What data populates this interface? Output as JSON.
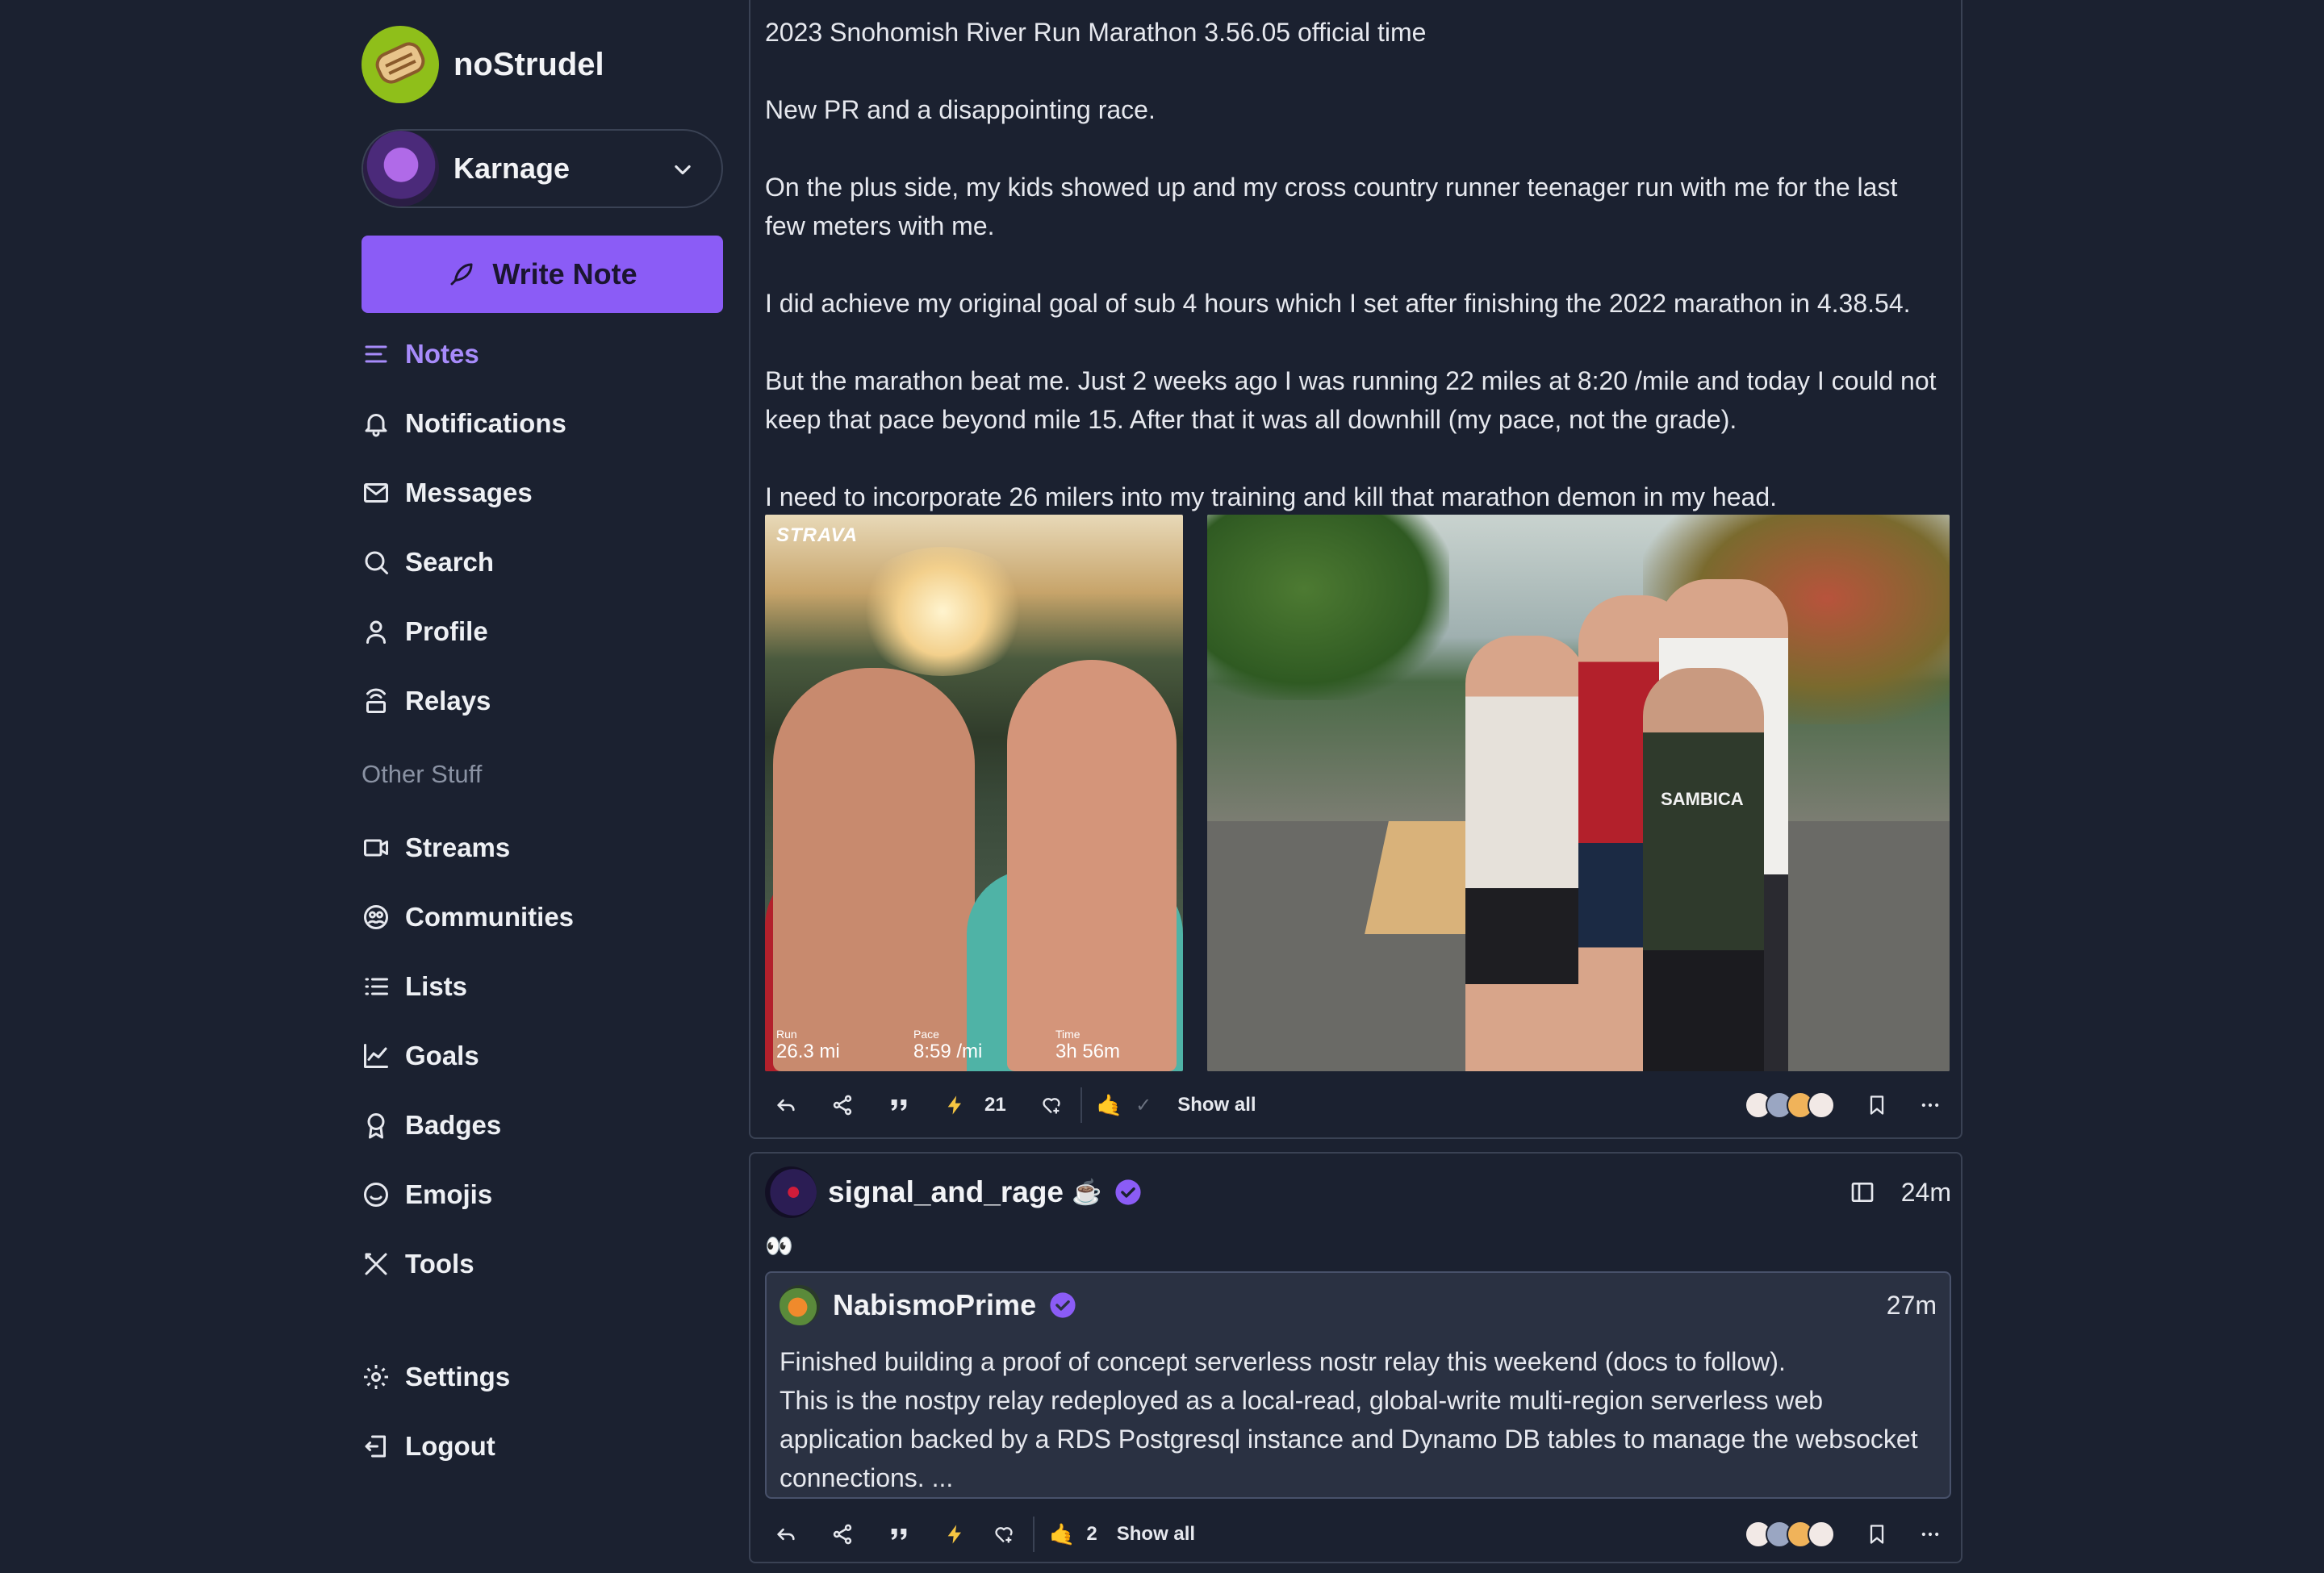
{
  "app": {
    "name": "noStrudel"
  },
  "account": {
    "name": "Karnage"
  },
  "write_button": {
    "label": "Write Note"
  },
  "nav": {
    "items": [
      {
        "label": "Notes",
        "icon": "notes-icon"
      },
      {
        "label": "Notifications",
        "icon": "bell-icon"
      },
      {
        "label": "Messages",
        "icon": "mail-icon"
      },
      {
        "label": "Search",
        "icon": "search-icon"
      },
      {
        "label": "Profile",
        "icon": "user-icon"
      },
      {
        "label": "Relays",
        "icon": "relay-icon"
      }
    ],
    "section_label": "Other Stuff",
    "other_items": [
      {
        "label": "Streams",
        "icon": "video-icon"
      },
      {
        "label": "Communities",
        "icon": "communities-icon"
      },
      {
        "label": "Lists",
        "icon": "list-icon"
      },
      {
        "label": "Goals",
        "icon": "chart-icon"
      },
      {
        "label": "Badges",
        "icon": "badge-icon"
      },
      {
        "label": "Emojis",
        "icon": "smile-icon"
      },
      {
        "label": "Tools",
        "icon": "tools-icon"
      }
    ],
    "bottom_items": [
      {
        "label": "Settings",
        "icon": "gear-icon"
      },
      {
        "label": "Logout",
        "icon": "logout-icon"
      }
    ],
    "active": "Notes"
  },
  "post1": {
    "paragraphs": [
      "2023 Snohomish River Run Marathon 3.56.05 official time",
      "New PR and a disappointing race.",
      "On the plus side, my kids showed up and my cross country runner teenager run with me for the last few meters with me.",
      "I did achieve my original goal of sub 4 hours which I set after finishing the 2022 marathon in 4.38.54.",
      "But the marathon beat me. Just 2 weeks ago I was running 22 miles at 8:20 /mile and today I could not keep that pace beyond mile 15. After that it was all downhill (my pace, not the grade).",
      "I need to incorporate 26 milers into my training and kill that marathon demon in my head."
    ],
    "image1": {
      "watermark": "STRAVA",
      "stats": [
        {
          "label": "Run",
          "value": "26.3 mi"
        },
        {
          "label": "Pace",
          "value": "8:59 /mi"
        },
        {
          "label": "Time",
          "value": "3h 56m"
        }
      ]
    },
    "image2": {
      "shirt_text": "SAMBICA"
    },
    "zap_count": "21",
    "reaction_emoji": "🤙",
    "reaction_check": "✓",
    "show_all": "Show all"
  },
  "post2": {
    "author": "signal_and_rage",
    "author_emoji": "☕",
    "time": "24m",
    "content": "👀",
    "quote": {
      "author": "NabismoPrime",
      "time": "27m",
      "text_lines": [
        "Finished building a proof of concept serverless nostr relay this weekend (docs to follow).",
        "This is the nostpy relay redeployed as a local-read, global-write multi-region serverless web application backed by a RDS Postgresql instance and Dynamo DB tables to manage the websocket connections. ..."
      ]
    },
    "reaction_emoji": "🤙",
    "reaction_count": "2",
    "show_all": "Show all"
  },
  "colors": {
    "accent": "#8b5cf6",
    "background": "#1b2130",
    "zap": "#f5c542"
  }
}
